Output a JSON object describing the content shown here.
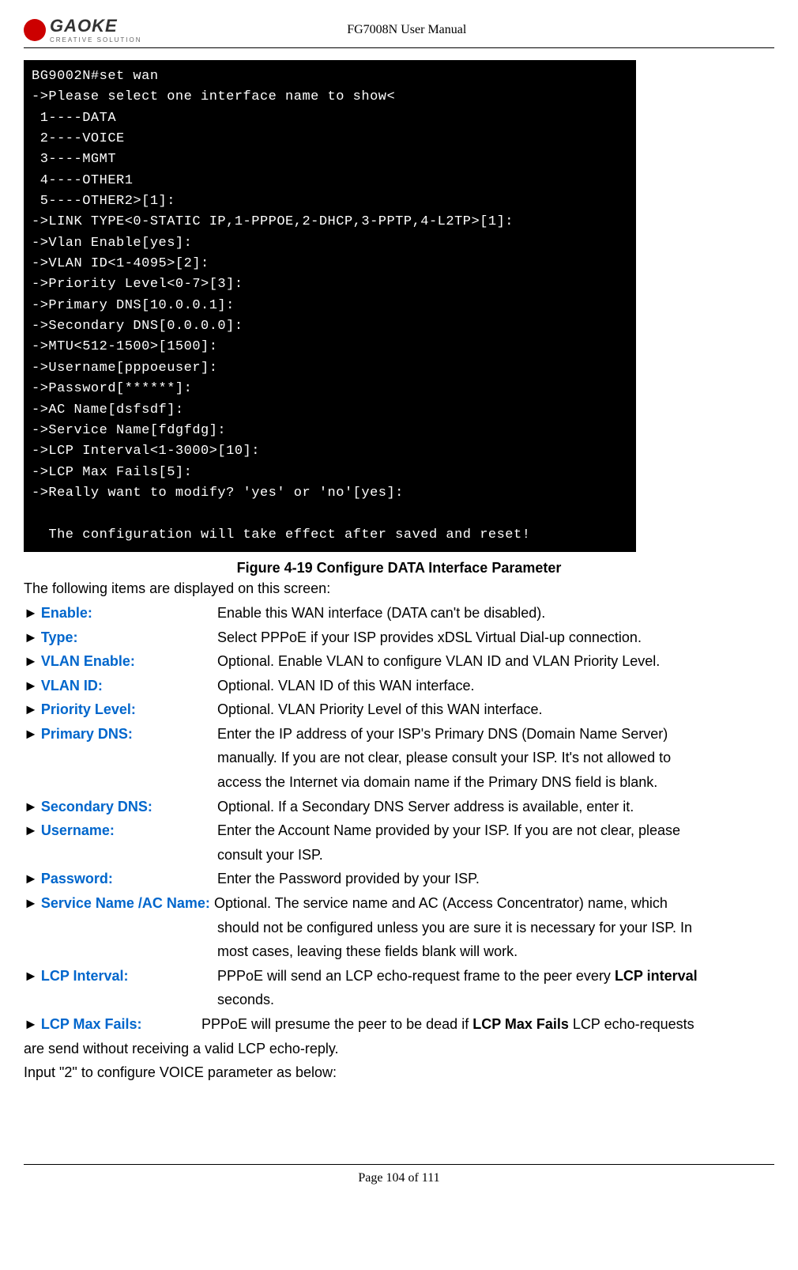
{
  "header": {
    "logo_main": "GAOKE",
    "logo_sub": "CREATIVE SOLUTION",
    "title": "FG7008N User Manual"
  },
  "terminal_text": "BG9002N#set wan\n->Please select one interface name to show<\n 1----DATA\n 2----VOICE\n 3----MGMT\n 4----OTHER1\n 5----OTHER2>[1]:\n->LINK TYPE<0-STATIC IP,1-PPPOE,2-DHCP,3-PPTP,4-L2TP>[1]:\n->Vlan Enable[yes]:\n->VLAN ID<1-4095>[2]:\n->Priority Level<0-7>[3]:\n->Primary DNS[10.0.0.1]:\n->Secondary DNS[0.0.0.0]:\n->MTU<512-1500>[1500]:\n->Username[pppoeuser]:\n->Password[******]:\n->AC Name[dsfsdf]:\n->Service Name[fdgfdg]:\n->LCP Interval<1-3000>[10]:\n->LCP Max Fails[5]:\n->Really want to modify? 'yes' or 'no'[yes]:\n\n  The configuration will take effect after saved and reset!\n",
  "figure_caption": "Figure 4-19   Configure DATA Interface Parameter",
  "intro": "The following items are displayed on this screen:",
  "params": {
    "enable": {
      "label": "Enable:",
      "desc": "Enable this WAN interface (DATA can't be disabled)."
    },
    "type": {
      "label": "Type:",
      "desc": "Select PPPoE if your ISP provides xDSL Virtual Dial-up connection."
    },
    "vlan_enable": {
      "label": "VLAN Enable:",
      "desc": "Optional. Enable VLAN to configure VLAN ID and VLAN Priority Level."
    },
    "vlan_id": {
      "label": "VLAN ID:",
      "desc": "Optional. VLAN ID of this WAN interface."
    },
    "priority_level": {
      "label": "Priority Level:",
      "desc": "Optional. VLAN Priority Level of this WAN interface."
    },
    "primary_dns": {
      "label": "Primary DNS:",
      "desc1": "Enter the IP address of your ISP's Primary DNS (Domain Name Server)",
      "desc2": "manually. If you are not clear, please consult your ISP. It's not allowed to",
      "desc3": "access the Internet via domain name if the Primary DNS field is blank."
    },
    "secondary_dns": {
      "label": "Secondary DNS:",
      "desc": "Optional. If a Secondary DNS Server address is available, enter it."
    },
    "username": {
      "label": "Username:",
      "desc1": "Enter the Account Name provided by your ISP. If you are not clear, please",
      "desc2": "consult your ISP."
    },
    "password": {
      "label": "Password:",
      "desc": "Enter the Password provided by your ISP."
    },
    "service_name": {
      "label": "Service Name /AC Name:",
      "desc1": " Optional. The service name and AC (Access Concentrator) name, which",
      "desc2": "should not be configured unless you are sure it is necessary for your ISP. In",
      "desc3": "most cases, leaving these fields blank will work."
    },
    "lcp_interval": {
      "label": "LCP Interval:",
      "desc1_pre": "PPPoE will send an LCP echo-request frame to the peer every ",
      "desc1_bold": "LCP interval",
      "desc2": "seconds."
    },
    "lcp_max_fails": {
      "label": "LCP Max Fails:",
      "desc_pre": "PPPoE will presume the peer to be dead if ",
      "desc_bold": "LCP Max Fails",
      "desc_post": " LCP echo-requests"
    },
    "lcp_tail": "are send without receiving a valid LCP echo-reply."
  },
  "closing": "Input \"2\" to configure VOICE parameter as below:",
  "footer": "Page 104 of 111"
}
